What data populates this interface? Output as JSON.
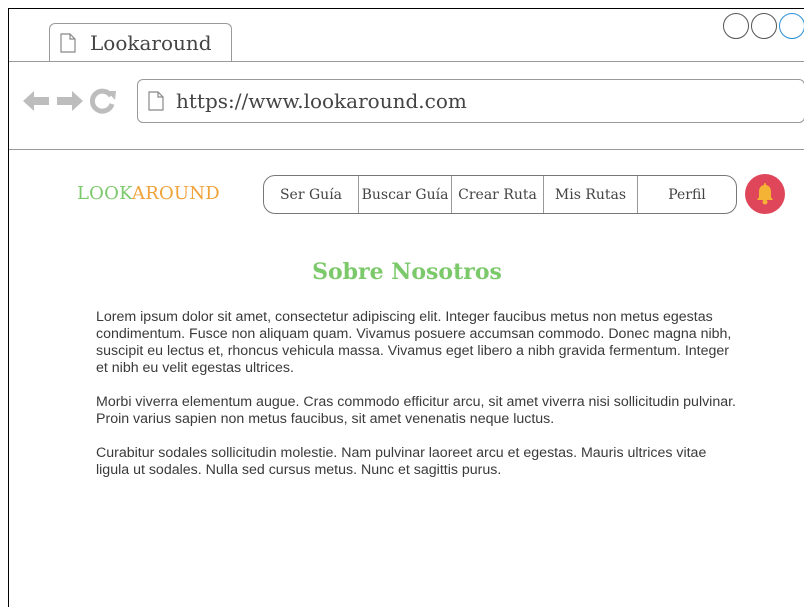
{
  "browser": {
    "tab_title": "Lookaround",
    "url": "https://www.lookaround.com"
  },
  "header": {
    "logo_part1": "LOOK",
    "logo_part2": "AROUND",
    "nav_items": [
      {
        "label": "Ser Guía"
      },
      {
        "label": "Buscar Guía"
      },
      {
        "label": "Crear Ruta"
      },
      {
        "label": "Mis Rutas"
      },
      {
        "label": "Perfil"
      }
    ],
    "notification_icon": "bell-icon"
  },
  "main": {
    "title": "Sobre Nosotros",
    "paragraphs": [
      "Lorem ipsum dolor sit amet, consectetur adipiscing elit. Integer faucibus metus non metus egestas condimentum. Fusce non aliquam quam. Vivamus posuere accumsan commodo. Donec magna nibh, suscipit eu lectus et, rhoncus vehicula massa. Vivamus eget libero a nibh gravida fermentum. Integer et nibh eu velit egestas ultrices.",
      "Morbi viverra elementum augue. Cras commodo efficitur arcu, sit amet viverra nisi sollicitudin pulvinar. Proin varius sapien non metus faucibus, sit amet venenatis neque luctus.",
      "Curabitur sodales sollicitudin molestie. Nam pulvinar laoreet arcu et egestas. Mauris ultrices vitae ligula ut sodales. Nulla sed cursus metus. Nunc et sagittis purus."
    ]
  },
  "colors": {
    "logo_green": "#7cc96b",
    "logo_orange": "#f0a23a",
    "title_green": "#7cc96b",
    "bell_red": "#e0465a",
    "window_accent": "#2b8fd8"
  }
}
